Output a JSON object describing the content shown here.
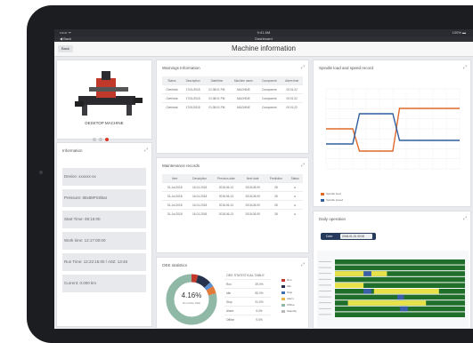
{
  "status_bar": {
    "left": "•••••• ᯤ",
    "time": "9:41 AM",
    "right": "100% ▬"
  },
  "nav": {
    "left": "◀ Back",
    "title": "Dashboard"
  },
  "header": {
    "back_label": "Back",
    "title": "Machine information"
  },
  "machine_card": {
    "name": "DESKTOP MACHINE",
    "page_count": 3,
    "active_page": 3
  },
  "info_card": {
    "title": "Information",
    "rows": [
      "Device: xxxxxx-xx",
      "Pressure: 88x88PSI/Bar",
      "Start Time: 08:15:00",
      "Work time: 12:17:00:00",
      "Run Time: 12:22:15:00 / A0Z: 13:48",
      "Current: 0.000 km"
    ]
  },
  "warnings_card": {
    "title": "Warnings Information",
    "headers": [
      "Status",
      "Description",
      "Date/time",
      "Machine name",
      "Component",
      "Alarm time"
    ],
    "rows": [
      [
        "Overheat",
        "17/01/2018",
        "01:38:01 PM",
        "MACHINE",
        "Component",
        "00:01:22"
      ],
      [
        "Overheat",
        "17/01/2018",
        "01:38:01 PM",
        "MACHINE",
        "Component",
        "00:01:22"
      ],
      [
        "Overheat",
        "17/01/2018",
        "01:38:01 PM",
        "MACHINE",
        "Component",
        "00:01:22"
      ]
    ]
  },
  "maintenance_card": {
    "title": "Maintenance records",
    "headers": [
      "Item",
      "Description",
      "Previous date",
      "Next date",
      "Prediction",
      "Status"
    ],
    "rows": [
      [
        "31-Jul-2018",
        "16-01-2018",
        "2018-06-13",
        "2018-08-09",
        "28",
        "●"
      ],
      [
        "31-Jul-2018",
        "16-01-2018",
        "2018-06-13",
        "2018-08-09",
        "28",
        "●"
      ],
      [
        "31-Jul-2018",
        "16-01-2018",
        "2018-06-13",
        "2018-08-09",
        "28",
        "●"
      ],
      [
        "31-Jul-2018",
        "16-01-2018",
        "2018-06-13",
        "2018-08-09",
        "28",
        "●"
      ]
    ]
  },
  "oee_card": {
    "title": "OEE statistics",
    "donut_value": "4.16%",
    "donut_caption": "Run Rate OEE",
    "table_title": "OEE STATISTICAL TABLE",
    "table_rows": [
      [
        "Run",
        "39.0%"
      ],
      [
        "Idle",
        "80.0%"
      ],
      [
        "Stop",
        "91.0%"
      ],
      [
        "Alarm",
        "6.0%"
      ],
      [
        "Offline",
        "9.0%"
      ]
    ],
    "legend": [
      {
        "label": "Run",
        "color": "#c0392b"
      },
      {
        "label": "Idle",
        "color": "#26324d"
      },
      {
        "label": "Stop",
        "color": "#3f6fb0"
      },
      {
        "label": "Alarm",
        "color": "#e8b64a"
      },
      {
        "label": "Offline",
        "color": "#8fb8a6"
      },
      {
        "label": "Standby",
        "color": "#b7b7b7"
      }
    ],
    "donut_segments": [
      {
        "value": 4.16,
        "color": "#c0392b"
      },
      {
        "value": 9,
        "color": "#26324d"
      },
      {
        "value": 3,
        "color": "#5a8fd0"
      },
      {
        "value": 5,
        "color": "#e37a3a"
      },
      {
        "value": 78.84,
        "color": "#8fb8a6"
      }
    ]
  },
  "spindle_card": {
    "title": "Spindle load and speed record",
    "legend": [
      {
        "label": "Spindle load",
        "color": "#e06a2c"
      },
      {
        "label": "Spindle speed",
        "color": "#2f5f9e"
      }
    ]
  },
  "chart_data": {
    "type": "line",
    "title": "Spindle load and speed record",
    "x": [
      0,
      1,
      2,
      3,
      4,
      5,
      6,
      7,
      8,
      9,
      10,
      11,
      12,
      13,
      14,
      15,
      16,
      17,
      18,
      19,
      20
    ],
    "series": [
      {
        "name": "Spindle load",
        "color": "#e06a2c",
        "values": [
          45,
          45,
          45,
          45,
          45,
          20,
          20,
          20,
          20,
          20,
          20,
          68,
          68,
          68,
          68,
          68,
          68,
          68,
          68,
          68,
          68
        ]
      },
      {
        "name": "Spindle speed",
        "color": "#2f5f9e",
        "values": [
          28,
          28,
          28,
          28,
          28,
          62,
          62,
          62,
          62,
          62,
          62,
          32,
          32,
          32,
          32,
          32,
          32,
          32,
          32,
          32,
          32
        ]
      }
    ],
    "ylim": [
      0,
      90
    ],
    "grid": true
  },
  "daily_card": {
    "title": "Daily operation",
    "search_label": "Date",
    "search_value": "2018-01-01 00:00"
  },
  "colors": {
    "accent": "#1f6f2a",
    "idle": "#e8e24a",
    "alarm": "#3a5fa8",
    "header": "#263a5c"
  }
}
